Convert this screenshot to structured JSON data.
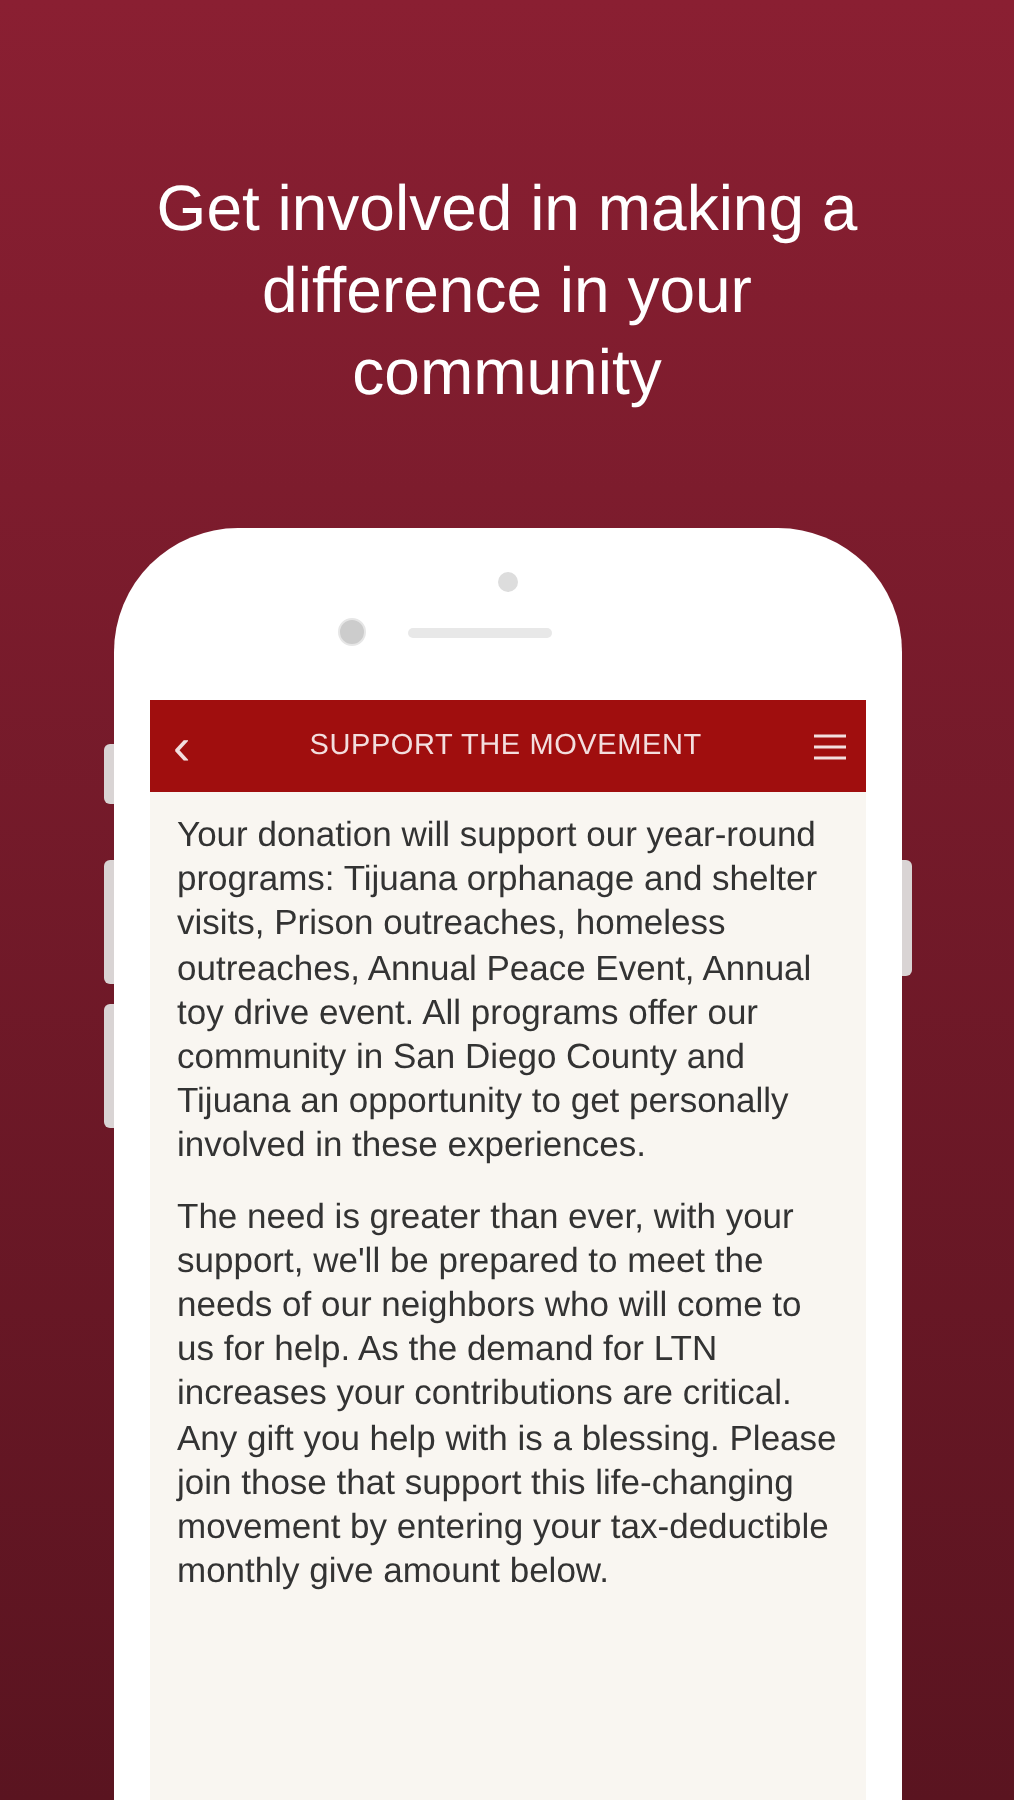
{
  "headline": "Get involved in making a difference in your community",
  "app_bar": {
    "back": "‹",
    "title": "SUPPORT THE MOVEMENT"
  },
  "paragraphs": [
    "Your donation will support our year-round programs: Tijuana orphanage and shelter visits, Prison outreaches, homeless outreaches, Annual Peace Event, Annual toy drive event. All programs offer our community in San Diego County and Tijuana an opportunity to get personally involved in these experiences.",
    "The need is greater than ever, with your support, we'll be prepared to meet the needs of our neighbors who will come to us for help. As the demand for LTN increases your contributions are critical. Any gift you help with is a blessing. Please join those that support this life-changing movement by entering your tax-deductible monthly give amount below."
  ]
}
